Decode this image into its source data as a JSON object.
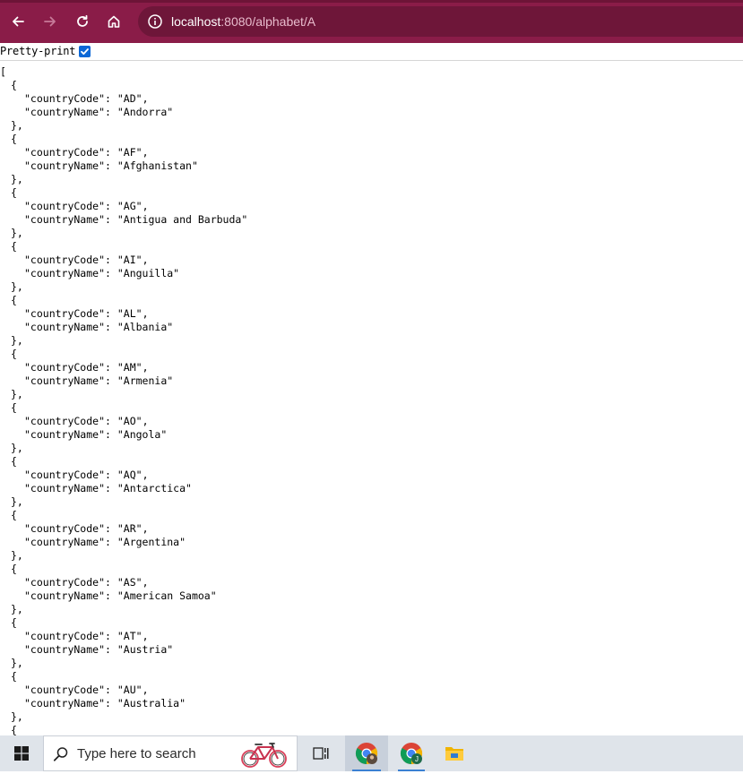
{
  "browser": {
    "url_host": "localhost",
    "url_path": ":8080/alphabet/A",
    "accent_color": "#8a1c48"
  },
  "pretty_print": {
    "label": "Pretty-print",
    "checked": true
  },
  "json": {
    "open_bracket": "[",
    "entries": [
      {
        "code": "AD",
        "name": "Andorra"
      },
      {
        "code": "AF",
        "name": "Afghanistan"
      },
      {
        "code": "AG",
        "name": "Antigua and Barbuda"
      },
      {
        "code": "AI",
        "name": "Anguilla"
      },
      {
        "code": "AL",
        "name": "Albania"
      },
      {
        "code": "AM",
        "name": "Armenia"
      },
      {
        "code": "AO",
        "name": "Angola"
      },
      {
        "code": "AQ",
        "name": "Antarctica"
      },
      {
        "code": "AR",
        "name": "Argentina"
      },
      {
        "code": "AS",
        "name": "American Samoa"
      },
      {
        "code": "AT",
        "name": "Austria"
      },
      {
        "code": "AU",
        "name": "Australia"
      }
    ]
  },
  "taskbar": {
    "search_placeholder": "Type here to search",
    "icons": [
      "windows-start-icon",
      "search-icon",
      "bicycle-icon",
      "task-view-icon",
      "chrome-icon",
      "chrome-profile-icon",
      "file-explorer-icon"
    ]
  }
}
